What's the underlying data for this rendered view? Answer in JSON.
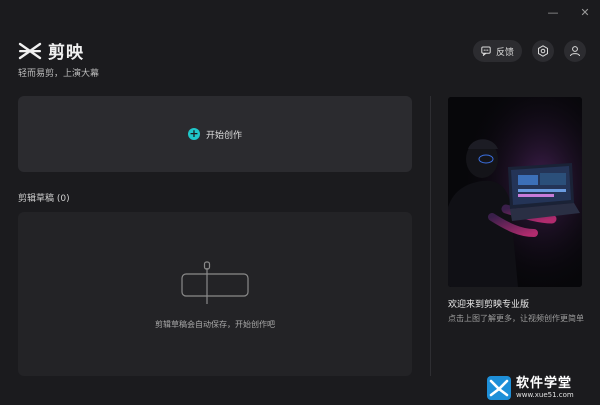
{
  "window": {
    "minimize_glyph": "—",
    "close_glyph": "✕"
  },
  "app": {
    "name": "剪映",
    "slogan": "轻而易剪，上演大幕"
  },
  "header": {
    "feedback_label": "反馈",
    "icons": [
      "feedback-icon",
      "settings-icon",
      "user-icon"
    ]
  },
  "create": {
    "label": "开始创作",
    "accent_color": "#1fc7c9"
  },
  "drafts": {
    "title": "剪辑草稿 (0)",
    "empty_text": "剪辑草稿会自动保存，开始创作吧"
  },
  "promo": {
    "title": "欢迎来到剪映专业版",
    "description": "点击上图了解更多，让视频创作更简单"
  },
  "watermark": {
    "name": "软件学堂",
    "domain": "www.xue51.com"
  }
}
